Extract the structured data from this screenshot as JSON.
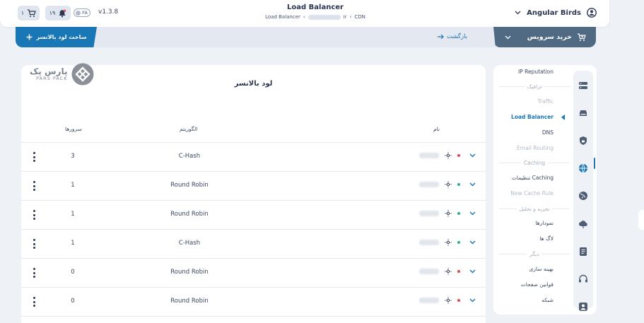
{
  "header": {
    "cart_count": "۱",
    "notification_count": "۱۹",
    "lang_label": "FA",
    "version": "v1.3.8",
    "title": "Load Balancer",
    "breadcrumbs": [
      "Load Balancer",
      "ir",
      "CDN"
    ],
    "user_name": "Angular Birds"
  },
  "actions": {
    "create_label": "ساخت لود بالانسر",
    "back_label": "بازگشت",
    "buy_label": "خرید سرویس"
  },
  "brand": {
    "name_fa": "پارس پک",
    "name_en": "PARS PACK"
  },
  "main": {
    "title": "لود بالانسر",
    "columns": {
      "name": "نام",
      "algorithm": "الگوریتم",
      "servers": "سرورها"
    },
    "rows": [
      {
        "servers": "3",
        "algorithm": "C-Hash",
        "status": "down"
      },
      {
        "servers": "1",
        "algorithm": "Round Robin",
        "status": "up"
      },
      {
        "servers": "1",
        "algorithm": "Round Robin",
        "status": "up"
      },
      {
        "servers": "1",
        "algorithm": "C-Hash",
        "status": "up"
      },
      {
        "servers": "0",
        "algorithm": "Round Robin",
        "status": "down"
      },
      {
        "servers": "0",
        "algorithm": "Round Robin",
        "status": "down"
      }
    ]
  },
  "sidebar": {
    "items": [
      {
        "label": "IP Reputation",
        "kind": "item"
      },
      {
        "label": "ترافیک",
        "kind": "section"
      },
      {
        "label": "Traffic",
        "kind": "muted"
      },
      {
        "label": "Load Balancer",
        "kind": "active"
      },
      {
        "label": "DNS",
        "kind": "item"
      },
      {
        "label": "Email Routing",
        "kind": "muted"
      },
      {
        "label": "Caching",
        "kind": "section"
      },
      {
        "label": "تنظیمات Caching",
        "kind": "item"
      },
      {
        "label": "New Cache Rule",
        "kind": "muted"
      },
      {
        "label": "تجزیه و تحلیل",
        "kind": "section"
      },
      {
        "label": "نمودارها",
        "kind": "item"
      },
      {
        "label": "لاگ ها",
        "kind": "item"
      },
      {
        "label": "دیگر",
        "kind": "section"
      },
      {
        "label": "بهینه سازی",
        "kind": "item"
      },
      {
        "label": "قوانین صفحات",
        "kind": "item"
      },
      {
        "label": "شبکه",
        "kind": "item"
      }
    ],
    "rail_icons": [
      "server-icon",
      "cloud-drive-icon",
      "shield-lock-icon",
      "globe-icon",
      "globe-alt-icon",
      "cloud-upload-icon",
      "document-icon",
      "headset-icon",
      "user-icon"
    ]
  },
  "colors": {
    "accent": "#1a77b5",
    "buy_button": "#4f6a82",
    "status_up": "#2fb37a",
    "status_down": "#e5484d"
  }
}
